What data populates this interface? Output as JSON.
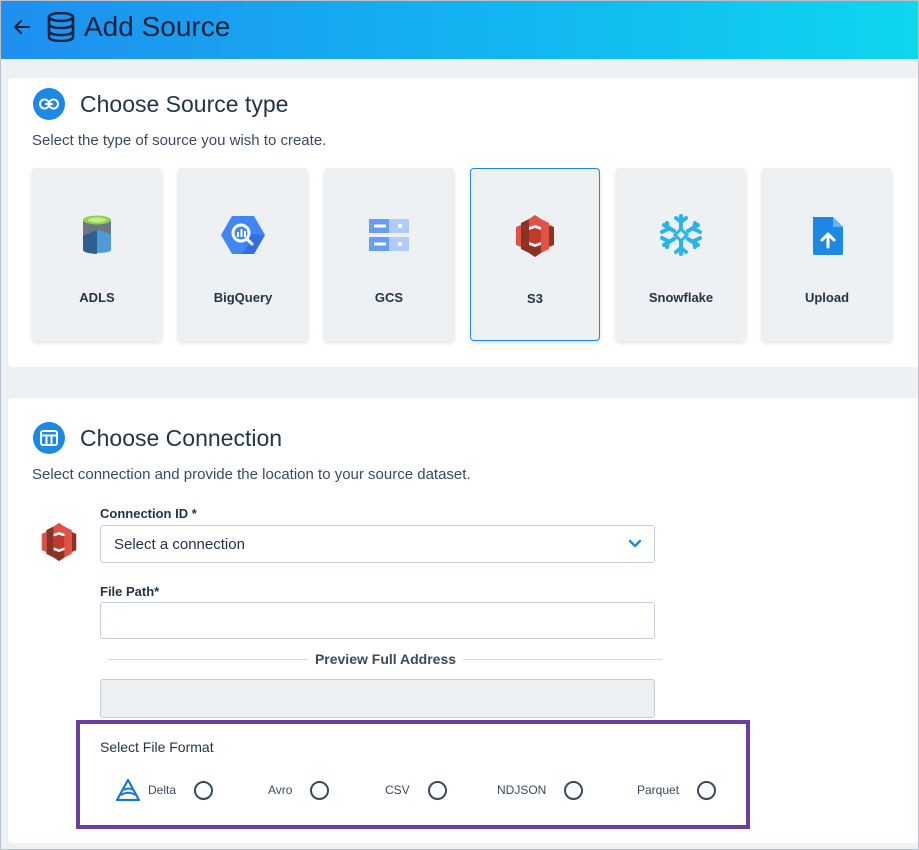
{
  "header": {
    "title": "Add Source"
  },
  "source_type": {
    "title": "Choose Source type",
    "description": "Select the type of source you wish to create.",
    "tiles": [
      {
        "label": "ADLS",
        "icon": "adls-icon"
      },
      {
        "label": "BigQuery",
        "icon": "bigquery-icon"
      },
      {
        "label": "GCS",
        "icon": "gcs-icon"
      },
      {
        "label": "S3",
        "icon": "s3-icon",
        "selected": true
      },
      {
        "label": "Snowflake",
        "icon": "snowflake-icon"
      },
      {
        "label": "Upload",
        "icon": "upload-icon"
      }
    ]
  },
  "connection": {
    "title": "Choose Connection",
    "description": "Select connection and provide the location to your source dataset.",
    "connection_id_label": "Connection ID *",
    "connection_select_value": "Select a connection",
    "file_path_label": "File Path*",
    "file_path_value": "",
    "preview_label": "Preview Full Address",
    "preview_value": ""
  },
  "file_format": {
    "title": "Select File Format",
    "options": [
      "Delta",
      "Avro",
      "CSV",
      "NDJSON",
      "Parquet"
    ],
    "selected": null
  },
  "colors": {
    "accent": "#1e88e5",
    "highlight_border": "#6b3fa0",
    "header_gradient_start": "#1f8ff0",
    "header_gradient_end": "#0fd6ef"
  }
}
